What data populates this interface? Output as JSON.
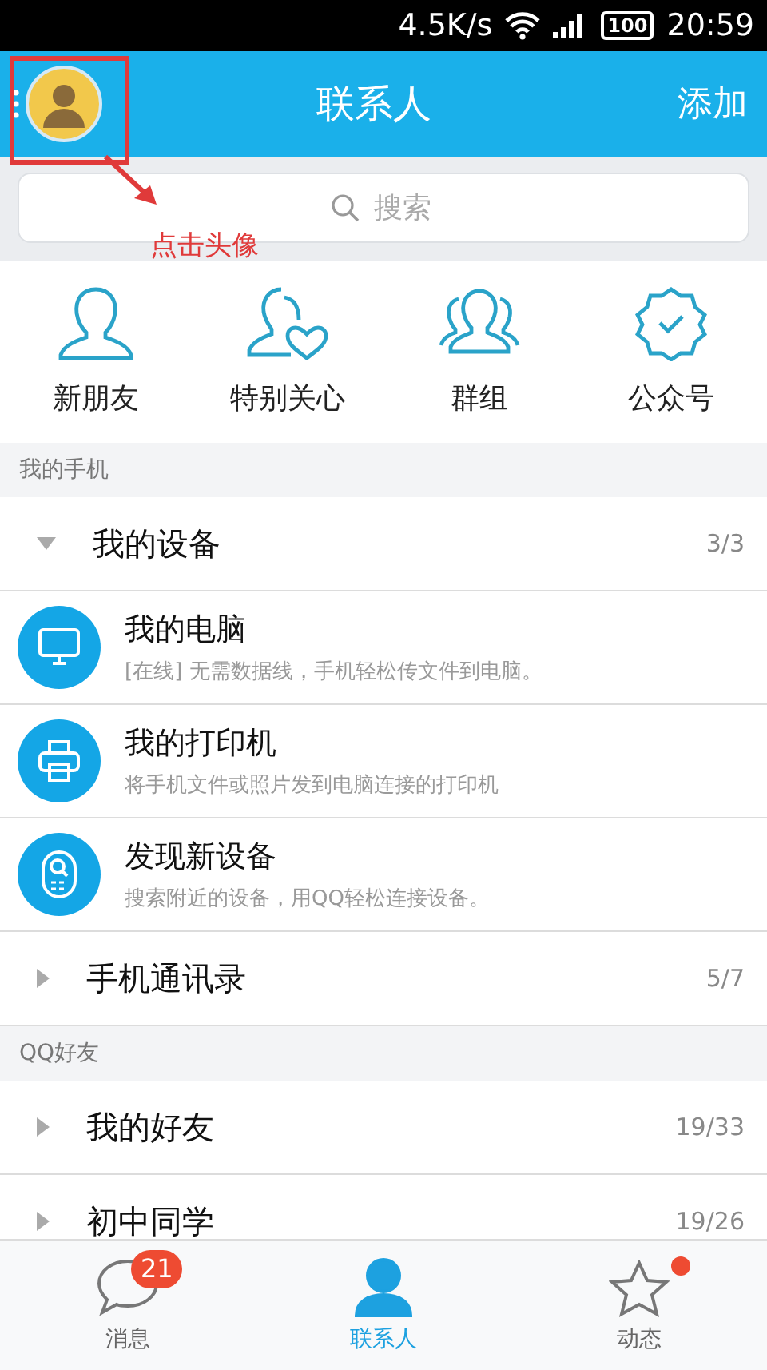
{
  "status_bar": {
    "speed": "4.5K/s",
    "battery": "100",
    "time": "20:59"
  },
  "header": {
    "title": "联系人",
    "action": "添加"
  },
  "annotation": {
    "text": "点击头像"
  },
  "search": {
    "placeholder": "搜索"
  },
  "shortcuts": [
    {
      "kind": "person",
      "label": "新朋友"
    },
    {
      "kind": "heart",
      "label": "特别关心"
    },
    {
      "kind": "group",
      "label": "群组"
    },
    {
      "kind": "badge",
      "label": "公众号"
    }
  ],
  "sections": [
    {
      "title": "我的手机",
      "groups": [
        {
          "name": "我的设备",
          "count": "3/3",
          "expanded": true,
          "devices": [
            {
              "kind": "computer",
              "name": "我的电脑",
              "desc": "[在线] 无需数据线，手机轻松传文件到电脑。"
            },
            {
              "kind": "printer",
              "name": "我的打印机",
              "desc": "将手机文件或照片发到电脑连接的打印机"
            },
            {
              "kind": "finder",
              "name": "发现新设备",
              "desc": "搜索附近的设备，用QQ轻松连接设备。"
            }
          ]
        },
        {
          "name": "手机通讯录",
          "count": "5/7",
          "expanded": false
        }
      ]
    },
    {
      "title": "QQ好友",
      "groups": [
        {
          "name": "我的好友",
          "count": "19/33",
          "expanded": false
        },
        {
          "name": "初中同学",
          "count": "19/26",
          "expanded": false
        }
      ]
    }
  ],
  "tabs": [
    {
      "kind": "messages",
      "label": "消息",
      "selected": false,
      "badge": "21",
      "dot": false
    },
    {
      "kind": "contacts",
      "label": "联系人",
      "selected": true,
      "dot": false
    },
    {
      "kind": "feed",
      "label": "动态",
      "selected": false,
      "dot": true
    }
  ]
}
